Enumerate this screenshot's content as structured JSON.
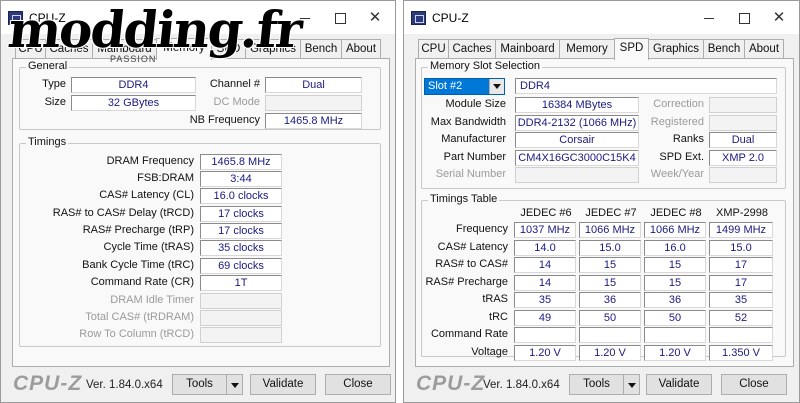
{
  "watermark": {
    "text": "modding.fr",
    "sub": "PASSION"
  },
  "left": {
    "title": "CPU-Z",
    "tabs": [
      "CPU",
      "Caches",
      "Mainboard",
      "Memory",
      "SPD",
      "Graphics",
      "Bench",
      "About"
    ],
    "active_tab": "Memory",
    "general": {
      "title": "General",
      "type_label": "Type",
      "type_value": "DDR4",
      "size_label": "Size",
      "size_value": "32 GBytes",
      "channel_label": "Channel #",
      "channel_value": "Dual",
      "dc_mode_label": "DC Mode",
      "dc_mode_value": "",
      "nb_freq_label": "NB Frequency",
      "nb_freq_value": "1465.8 MHz"
    },
    "timings": {
      "title": "Timings",
      "rows": [
        {
          "label": "DRAM Frequency",
          "value": "1465.8 MHz",
          "enabled": true
        },
        {
          "label": "FSB:DRAM",
          "value": "3:44",
          "enabled": true
        },
        {
          "label": "CAS# Latency (CL)",
          "value": "16.0 clocks",
          "enabled": true
        },
        {
          "label": "RAS# to CAS# Delay (tRCD)",
          "value": "17 clocks",
          "enabled": true
        },
        {
          "label": "RAS# Precharge (tRP)",
          "value": "17 clocks",
          "enabled": true
        },
        {
          "label": "Cycle Time (tRAS)",
          "value": "35 clocks",
          "enabled": true
        },
        {
          "label": "Bank Cycle Time (tRC)",
          "value": "69 clocks",
          "enabled": true
        },
        {
          "label": "Command Rate (CR)",
          "value": "1T",
          "enabled": true
        },
        {
          "label": "DRAM Idle Timer",
          "value": "",
          "enabled": false
        },
        {
          "label": "Total CAS# (tRDRAM)",
          "value": "",
          "enabled": false
        },
        {
          "label": "Row To Column (tRCD)",
          "value": "",
          "enabled": false
        }
      ]
    },
    "bottom": {
      "logo": "CPU-Z",
      "version": "Ver. 1.84.0.x64",
      "tools": "Tools",
      "validate": "Validate",
      "close": "Close"
    }
  },
  "right": {
    "title": "CPU-Z",
    "tabs": [
      "CPU",
      "Caches",
      "Mainboard",
      "Memory",
      "SPD",
      "Graphics",
      "Bench",
      "About"
    ],
    "active_tab": "SPD",
    "slot": {
      "title": "Memory Slot Selection",
      "selected": "Slot #2",
      "type_value": "DDR4",
      "module_size_label": "Module Size",
      "module_size_value": "16384 MBytes",
      "max_bw_label": "Max Bandwidth",
      "max_bw_value": "DDR4-2132 (1066 MHz)",
      "manufacturer_label": "Manufacturer",
      "manufacturer_value": "Corsair",
      "part_label": "Part Number",
      "part_value": "CM4X16GC3000C15K4",
      "serial_label": "Serial Number",
      "serial_value": "",
      "correction_label": "Correction",
      "correction_value": "",
      "registered_label": "Registered",
      "registered_value": "",
      "ranks_label": "Ranks",
      "ranks_value": "Dual",
      "spd_ext_label": "SPD Ext.",
      "spd_ext_value": "XMP 2.0",
      "week_label": "Week/Year",
      "week_value": ""
    },
    "timings_table": {
      "title": "Timings Table",
      "columns": [
        "JEDEC #6",
        "JEDEC #7",
        "JEDEC #8",
        "XMP-2998"
      ],
      "rows": [
        {
          "label": "Frequency",
          "values": [
            "1037 MHz",
            "1066 MHz",
            "1066 MHz",
            "1499 MHz"
          ]
        },
        {
          "label": "CAS# Latency",
          "values": [
            "14.0",
            "15.0",
            "16.0",
            "15.0"
          ]
        },
        {
          "label": "RAS# to CAS#",
          "values": [
            "14",
            "15",
            "15",
            "17"
          ]
        },
        {
          "label": "RAS# Precharge",
          "values": [
            "14",
            "15",
            "15",
            "17"
          ]
        },
        {
          "label": "tRAS",
          "values": [
            "35",
            "36",
            "36",
            "35"
          ]
        },
        {
          "label": "tRC",
          "values": [
            "49",
            "50",
            "50",
            "52"
          ]
        },
        {
          "label": "Command Rate",
          "values": [
            "",
            "",
            "",
            ""
          ]
        },
        {
          "label": "Voltage",
          "values": [
            "1.20 V",
            "1.20 V",
            "1.20 V",
            "1.350 V"
          ]
        }
      ]
    },
    "bottom": {
      "logo": "CPU-Z",
      "version": "Ver. 1.84.0.x64",
      "tools": "Tools",
      "validate": "Validate",
      "close": "Close"
    }
  }
}
